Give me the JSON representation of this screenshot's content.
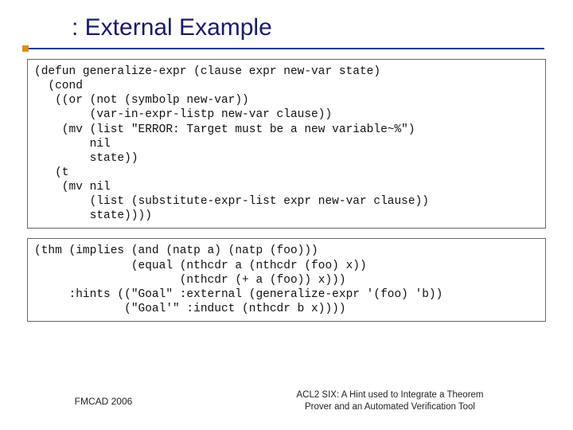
{
  "title": ": External Example",
  "code": {
    "block1": "(defun generalize-expr (clause expr new-var state)\n  (cond\n   ((or (not (symbolp new-var))\n        (var-in-expr-listp new-var clause))\n    (mv (list \"ERROR: Target must be a new variable~%\")\n        nil\n        state))\n   (t\n    (mv nil\n        (list (substitute-expr-list expr new-var clause))\n        state))))",
    "block2": "(thm (implies (and (natp a) (natp (foo)))\n              (equal (nthcdr a (nthcdr (foo) x))\n                     (nthcdr (+ a (foo)) x)))\n     :hints ((\"Goal\" :external (generalize-expr '(foo) 'b))\n             (\"Goal'\" :induct (nthcdr b x))))"
  },
  "footer": {
    "left": "FMCAD 2006",
    "right_line1": "ACL2 SIX: A Hint used to Integrate a Theorem",
    "right_line2": "Prover and an Automated Verification Tool"
  }
}
